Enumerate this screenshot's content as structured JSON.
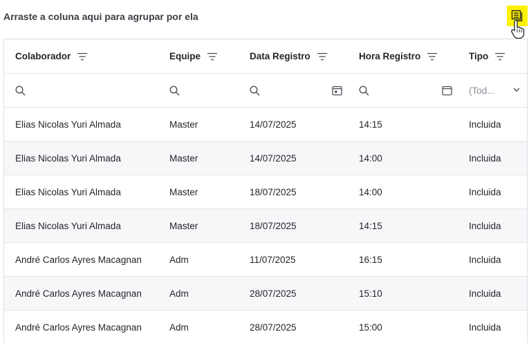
{
  "group_panel": {
    "hint": "Arraste a coluna aqui para agrupar por ela"
  },
  "columns": [
    "Colaborador",
    "Equipe",
    "Data Registro",
    "Hora Registro",
    "Tipo"
  ],
  "filter": {
    "tipo_placeholder": "(Tod..."
  },
  "rows": [
    [
      "Elias Nicolas Yuri Almada",
      "Master",
      "14/07/2025",
      "14:15",
      "Incluida"
    ],
    [
      "Elias Nicolas Yuri Almada",
      "Master",
      "14/07/2025",
      "14:00",
      "Incluida"
    ],
    [
      "Elias Nicolas Yuri Almada",
      "Master",
      "18/07/2025",
      "14:00",
      "Incluida"
    ],
    [
      "Elias Nicolas Yuri Almada",
      "Master",
      "18/07/2025",
      "14:15",
      "Incluida"
    ],
    [
      "André Carlos Ayres Macagnan",
      "Adm",
      "11/07/2025",
      "16:15",
      "Incluida"
    ],
    [
      "André Carlos Ayres Macagnan",
      "Adm",
      "28/07/2025",
      "15:10",
      "Incluida"
    ],
    [
      "André Carlos Ayres Macagnan",
      "Adm",
      "28/07/2025",
      "15:00",
      "Incluida"
    ]
  ],
  "colors": {
    "highlight": "#fff200",
    "border": "#dcdfe3",
    "alt_row": "#f7f7f9"
  },
  "icons": {
    "column_chooser": "column-chooser-icon",
    "cursor": "hand-pointer-icon",
    "sort": "filter-lines-icon",
    "search": "search-icon",
    "calendar": "calendar-icon",
    "dropdown": "chevron-down-icon"
  }
}
